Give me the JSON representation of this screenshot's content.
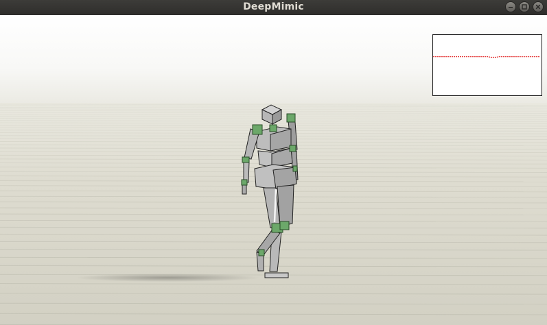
{
  "window": {
    "title": "DeepMimic",
    "controls": [
      "minimize",
      "maximize",
      "close"
    ]
  },
  "scene": {
    "sky_color": "#fbfbfb",
    "ground_color": "#d9d8cc",
    "character_color": "#b8b8b8",
    "joint_color": "#6ca86a"
  },
  "plot": {
    "background": "#ffffff",
    "line_color": "#e02020",
    "line_level": 0.36
  }
}
